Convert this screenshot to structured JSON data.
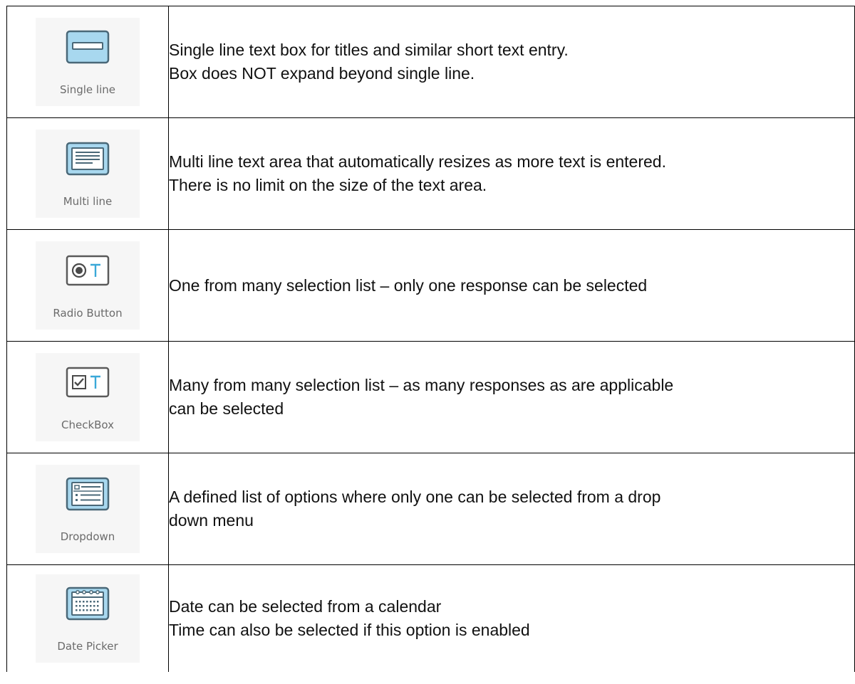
{
  "rows": [
    {
      "icon": "single-line-icon",
      "label": "Single line",
      "lines": [
        "Single line text box for titles and similar short text entry.",
        "Box does NOT expand beyond single line."
      ]
    },
    {
      "icon": "multi-line-icon",
      "label": "Multi line",
      "lines": [
        "Multi line text area that automatically resizes as more text is entered.",
        "There is no limit on the size of the text area."
      ]
    },
    {
      "icon": "radio-button-icon",
      "label": "Radio Button",
      "lines": [
        "One from many selection list – only one response can be selected"
      ]
    },
    {
      "icon": "checkbox-icon",
      "label": "CheckBox",
      "lines": [
        "Many from many selection list – as many responses as are applicable",
        "can be selected"
      ]
    },
    {
      "icon": "dropdown-icon",
      "label": "Dropdown",
      "lines": [
        "A defined list of options where only one can be selected from a drop",
        "down menu"
      ]
    },
    {
      "icon": "date-picker-icon",
      "label": "Date Picker",
      "lines": [
        "Date can be selected from a calendar",
        "Time can also be selected if this option is enabled"
      ]
    }
  ],
  "colors": {
    "icon_fill": "#a8d8ef",
    "icon_stroke": "#4a6878",
    "accent": "#3aa8d8"
  }
}
